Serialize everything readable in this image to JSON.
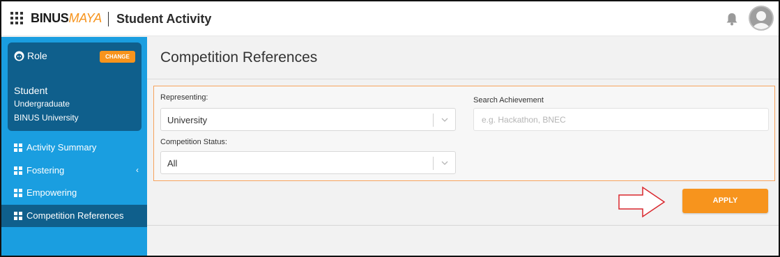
{
  "header": {
    "brand_main": "BINUS",
    "brand_accent": "MAYA",
    "app_title": "Student Activity",
    "icons": {
      "apps": "apps-grid-icon",
      "notifications": "bell-icon",
      "profile": "user-avatar"
    }
  },
  "sidebar": {
    "role": {
      "label": "Role",
      "change_label": "CHANGE",
      "name": "Student",
      "level": "Undergraduate",
      "institution": "BINUS University"
    },
    "items": [
      {
        "label": "Activity Summary",
        "icon": "dashboard-icon",
        "active": false,
        "has_submenu": false
      },
      {
        "label": "Fostering",
        "icon": "dashboard-icon",
        "active": false,
        "has_submenu": true,
        "chevron": "‹"
      },
      {
        "label": "Empowering",
        "icon": "dashboard-icon",
        "active": false,
        "has_submenu": false
      },
      {
        "label": "Competition References",
        "icon": "dashboard-icon",
        "active": true,
        "has_submenu": false
      }
    ]
  },
  "main": {
    "title": "Competition References",
    "filters": {
      "representing": {
        "label": "Representing:",
        "value": "University"
      },
      "competition_status": {
        "label": "Competition Status:",
        "value": "All"
      },
      "search": {
        "label": "Search Achievement",
        "placeholder": "e.g. Hackathon, BNEC",
        "value": ""
      }
    },
    "apply_label": "APPLY"
  },
  "colors": {
    "accent_orange": "#f7941d",
    "sidebar_blue": "#1a9ee0",
    "sidebar_dark": "#0f5f8c",
    "annotation_red": "#d9262c"
  }
}
